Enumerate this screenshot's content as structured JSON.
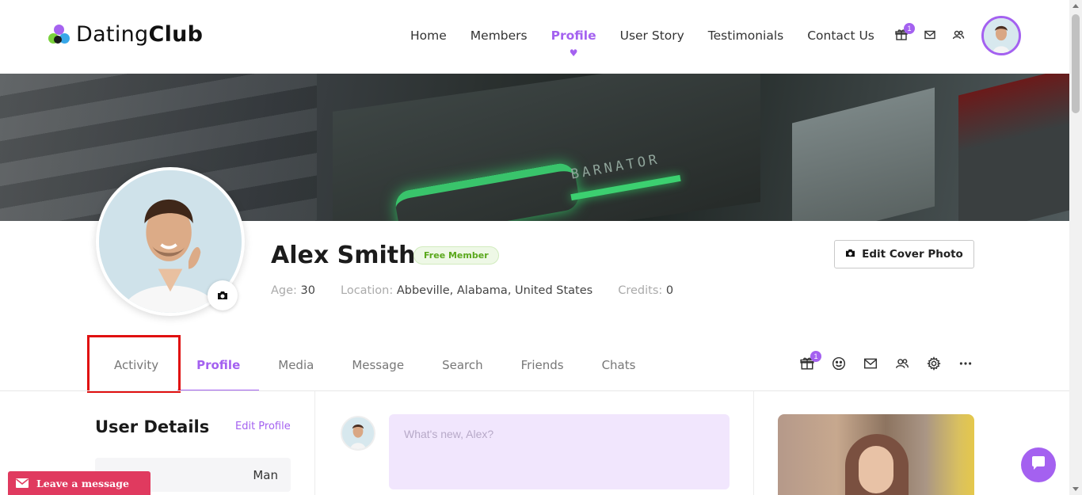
{
  "app": {
    "logo_light": "Dating",
    "logo_bold": "Club"
  },
  "nav": {
    "items": [
      {
        "label": "Home"
      },
      {
        "label": "Members"
      },
      {
        "label": "Profile",
        "active": true
      },
      {
        "label": "User Story"
      },
      {
        "label": "Testimonials"
      },
      {
        "label": "Contact Us"
      }
    ],
    "gift_badge": "1"
  },
  "profile": {
    "name": "Alex Smith",
    "membership": "Free Member",
    "age_label": "Age:",
    "age": "30",
    "location_label": "Location:",
    "location": "Abbeville, Alabama, United States",
    "credits_label": "Credits:",
    "credits": "0",
    "edit_cover_label": "Edit Cover Photo"
  },
  "tabs": {
    "items": [
      {
        "label": "Activity"
      },
      {
        "label": "Profile",
        "active": true
      },
      {
        "label": "Media"
      },
      {
        "label": "Message"
      },
      {
        "label": "Search"
      },
      {
        "label": "Friends"
      },
      {
        "label": "Chats"
      }
    ],
    "gift_badge": "1"
  },
  "user_details": {
    "title": "User Details",
    "edit_label": "Edit Profile",
    "gender_value": "Man"
  },
  "composer": {
    "placeholder": "What's new, Alex?"
  },
  "widgets": {
    "leave_message": "Leave a message"
  },
  "colors": {
    "accent": "#a461f0",
    "free_badge_text": "#5aa81c",
    "leave_message_bg": "#e03a5f",
    "highlight": "#e01010"
  },
  "icons": {
    "gift": "gift-icon",
    "mail": "mail-icon",
    "friends": "friends-icon",
    "smile": "smile-icon",
    "settings": "gear-icon",
    "more": "more-icon",
    "camera": "camera-icon",
    "chat": "chat-icon"
  }
}
